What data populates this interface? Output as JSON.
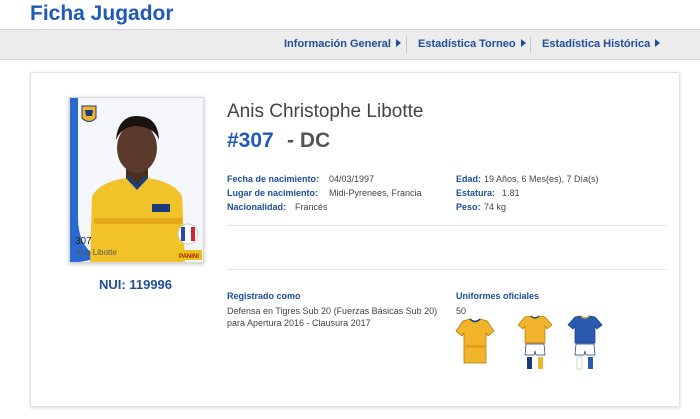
{
  "header": {
    "title": "Ficha Jugador"
  },
  "nav": {
    "items": [
      {
        "label": "Información General"
      },
      {
        "label": "Estadística Torneo"
      },
      {
        "label": "Estadística Histórica"
      }
    ]
  },
  "player": {
    "full_name": "Anis Christophe Libotte",
    "number": "#307",
    "position_separator": "-",
    "position": "DC",
    "nui_label": "NUI:",
    "nui": "119996",
    "sticker": {
      "number": "307",
      "name": "Anis Libotte",
      "brand": "PANINI"
    }
  },
  "details": {
    "birth_date_label": "Fecha de nacimiento:",
    "birth_date": "04/03/1997",
    "birth_place_label": "Lugar de nacimiento:",
    "birth_place": "Midi-Pyrenees, Francia",
    "nationality_label": "Nacionalidad:",
    "nationality": "Francés",
    "age_label": "Edad:",
    "age": "19 Años, 6 Mes(es), 7 Día(s)",
    "height_label": "Estatura:",
    "height": "1.81",
    "weight_label": "Peso:",
    "weight": "74 kg"
  },
  "registration": {
    "title": "Registrado como",
    "line1": "Defensa en Tigres Sub 20 (Fuerzas Básicas Sub 20)",
    "line2": "para Apertura 2016 - Clausura 2017"
  },
  "uniforms": {
    "title": "Uniformes oficiales",
    "number": "50"
  },
  "colors": {
    "brand_blue": "#1e5ab6",
    "kit_yellow": "#f2b42a",
    "kit_blue": "#2a5bb0"
  }
}
